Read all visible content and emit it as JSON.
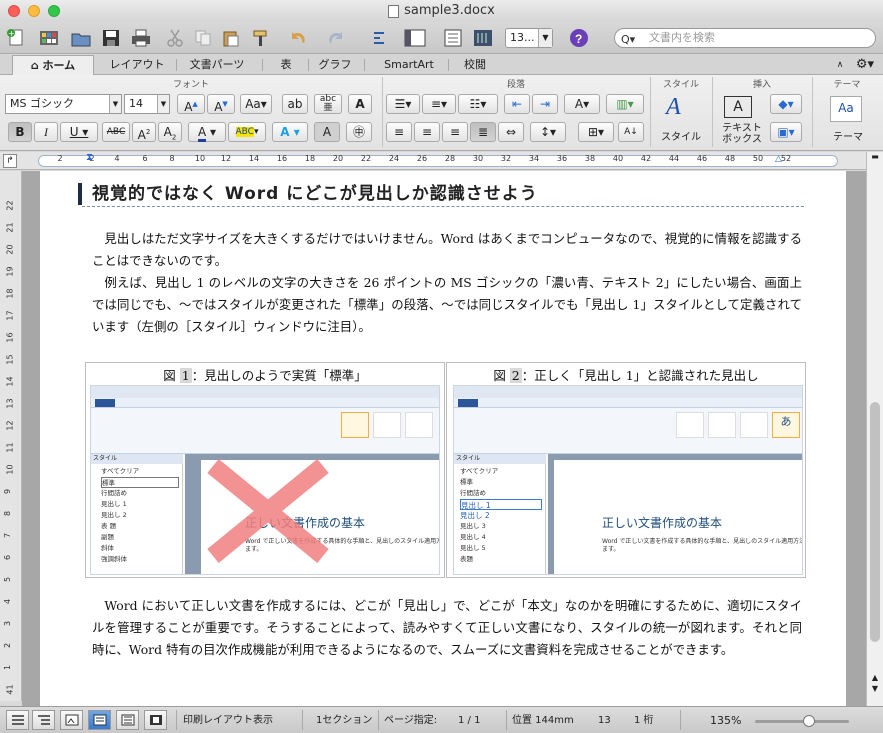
{
  "window": {
    "title": "sample3.docx"
  },
  "toolbar": {
    "zoom": "13...",
    "search_placeholder": "文書内を検索"
  },
  "tabs": [
    "ホーム",
    "レイアウト",
    "文書パーツ",
    "表",
    "グラフ",
    "SmartArt",
    "校閲"
  ],
  "ribbon": {
    "groups": {
      "font": "フォント",
      "paragraph": "段落",
      "style": "スタイル",
      "insert": "挿入",
      "theme": "テーマ"
    },
    "font_name": "MS ゴシック",
    "font_size": "14",
    "style_button": "スタイル",
    "textbox_button_line1": "テキスト",
    "textbox_button_line2": "ボックス",
    "theme_button": "テーマ"
  },
  "ruler": {
    "marks": [
      "2",
      "2",
      "4",
      "6",
      "8",
      "10",
      "12",
      "14",
      "16",
      "18",
      "20",
      "22",
      "24",
      "26",
      "28",
      "30",
      "32",
      "34",
      "36",
      "38",
      "40",
      "42",
      "44",
      "46",
      "48",
      "50",
      "52"
    ]
  },
  "vruler": {
    "marks": [
      "22",
      "21",
      "20",
      "19",
      "18",
      "17",
      "16",
      "15",
      "14",
      "13",
      "12",
      "11",
      "10",
      "9",
      "8",
      "7",
      "6",
      "5",
      "4",
      "3",
      "2",
      "1",
      "41",
      "42"
    ]
  },
  "document": {
    "heading": "視覚的ではなく Word にどこが見出しか認識させよう",
    "para1": "見出しはただ文字サイズを大きくするだけではいけません。Word はあくまでコンピュータなので、視覚的に情報を認識することはできないのです。",
    "para2": "例えば、見出し 1 のレベルの文字の大きさを 26 ポイントの MS ゴシックの「濃い青、テキスト 2」にしたい場合、画面上では同じでも、～ではスタイルが変更された「標準」の段落、～では同じスタイルでも「見出し 1」スタイルとして定義されています（左側の［スタイル］ウィンドウに注目）。",
    "fig1": {
      "prefix": "図 ",
      "num": "1",
      "caption": "：見出しのようで実質「標準」"
    },
    "fig2": {
      "prefix": "図 ",
      "num": "2",
      "caption": "：正しく「見出し 1」と認識された見出し"
    },
    "shot_doc_title": "正しい文書作成の基本",
    "shot_body": "Word で正しい文書を作成する具体的な手順と、見出しのスタイル適用方法に",
    "shot_body2": "ます。",
    "shot_styles_title": "スタイル",
    "shot1_styles": [
      "すべてクリア",
      "標準",
      "行間詰め",
      "見出し 1",
      "見出し 2",
      "表 題",
      "副題",
      "斜体",
      "強調斜体"
    ],
    "shot2_styles": [
      "すべてクリア",
      "標準",
      "行間詰め",
      "見出し 1",
      "見出し 2",
      "見出し 3",
      "見出し 4",
      "見出し 5",
      "表題"
    ],
    "para3": "Word において正しい文書を作成するには、どこが「見出し」で、どこが「本文」なのかを明確にするために、適切にスタイルを管理することが重要です。そうすることによって、読みやすくて正しい文書になり、スタイルの統一が図れます。それと同時に、Word 特有の目次作成機能が利用できるようになるので、スムーズに文書資料を完成させることができます。"
  },
  "status": {
    "view": "印刷レイアウト表示",
    "section": "1セクション",
    "page_label": "ページ指定:",
    "page": "1 / 1",
    "position": "位置 144mm",
    "line": "13",
    "column": "1 桁",
    "zoom": "135%"
  },
  "colors": {
    "accent": "#2f6ec9",
    "heading_bar": "#1f2d44",
    "x_mark": "#f08080"
  }
}
